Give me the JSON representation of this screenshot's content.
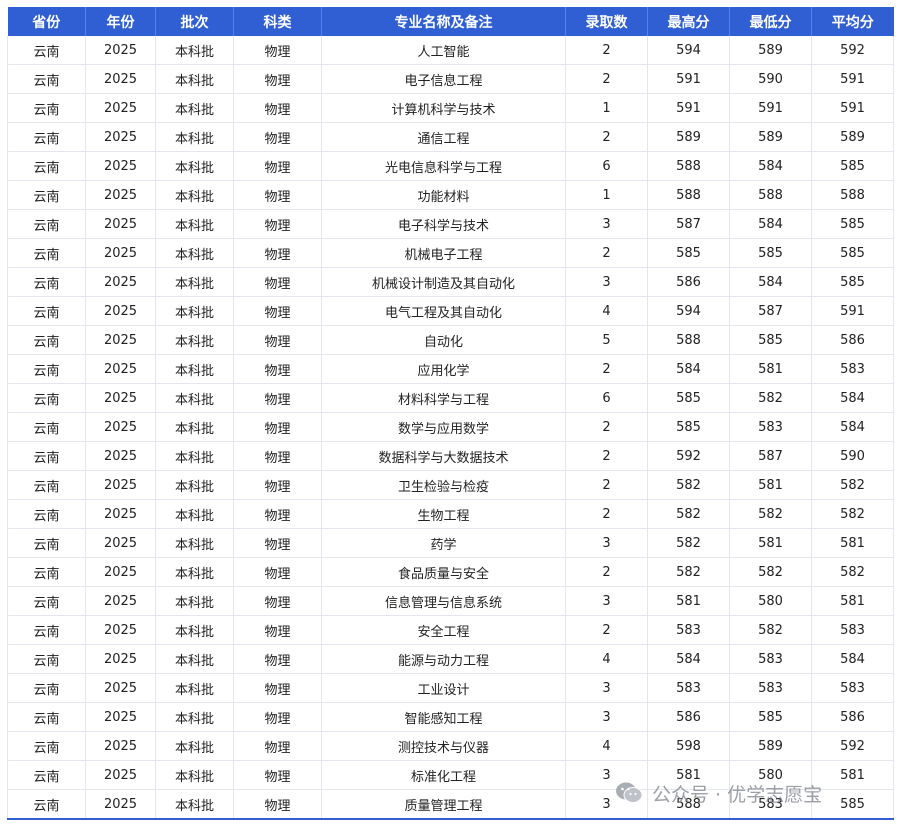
{
  "headers": [
    "省份",
    "年份",
    "批次",
    "科类",
    "专业名称及备注",
    "录取数",
    "最高分",
    "最低分",
    "平均分"
  ],
  "rows": [
    [
      "云南",
      "2025",
      "本科批",
      "物理",
      "人工智能",
      "2",
      "594",
      "589",
      "592"
    ],
    [
      "云南",
      "2025",
      "本科批",
      "物理",
      "电子信息工程",
      "2",
      "591",
      "590",
      "591"
    ],
    [
      "云南",
      "2025",
      "本科批",
      "物理",
      "计算机科学与技术",
      "1",
      "591",
      "591",
      "591"
    ],
    [
      "云南",
      "2025",
      "本科批",
      "物理",
      "通信工程",
      "2",
      "589",
      "589",
      "589"
    ],
    [
      "云南",
      "2025",
      "本科批",
      "物理",
      "光电信息科学与工程",
      "6",
      "588",
      "584",
      "585"
    ],
    [
      "云南",
      "2025",
      "本科批",
      "物理",
      "功能材料",
      "1",
      "588",
      "588",
      "588"
    ],
    [
      "云南",
      "2025",
      "本科批",
      "物理",
      "电子科学与技术",
      "3",
      "587",
      "584",
      "585"
    ],
    [
      "云南",
      "2025",
      "本科批",
      "物理",
      "机械电子工程",
      "2",
      "585",
      "585",
      "585"
    ],
    [
      "云南",
      "2025",
      "本科批",
      "物理",
      "机械设计制造及其自动化",
      "3",
      "586",
      "584",
      "585"
    ],
    [
      "云南",
      "2025",
      "本科批",
      "物理",
      "电气工程及其自动化",
      "4",
      "594",
      "587",
      "591"
    ],
    [
      "云南",
      "2025",
      "本科批",
      "物理",
      "自动化",
      "5",
      "588",
      "585",
      "586"
    ],
    [
      "云南",
      "2025",
      "本科批",
      "物理",
      "应用化学",
      "2",
      "584",
      "581",
      "583"
    ],
    [
      "云南",
      "2025",
      "本科批",
      "物理",
      "材料科学与工程",
      "6",
      "585",
      "582",
      "584"
    ],
    [
      "云南",
      "2025",
      "本科批",
      "物理",
      "数学与应用数学",
      "2",
      "585",
      "583",
      "584"
    ],
    [
      "云南",
      "2025",
      "本科批",
      "物理",
      "数据科学与大数据技术",
      "2",
      "592",
      "587",
      "590"
    ],
    [
      "云南",
      "2025",
      "本科批",
      "物理",
      "卫生检验与检疫",
      "2",
      "582",
      "581",
      "582"
    ],
    [
      "云南",
      "2025",
      "本科批",
      "物理",
      "生物工程",
      "2",
      "582",
      "582",
      "582"
    ],
    [
      "云南",
      "2025",
      "本科批",
      "物理",
      "药学",
      "3",
      "582",
      "581",
      "581"
    ],
    [
      "云南",
      "2025",
      "本科批",
      "物理",
      "食品质量与安全",
      "2",
      "582",
      "582",
      "582"
    ],
    [
      "云南",
      "2025",
      "本科批",
      "物理",
      "信息管理与信息系统",
      "3",
      "581",
      "580",
      "581"
    ],
    [
      "云南",
      "2025",
      "本科批",
      "物理",
      "安全工程",
      "2",
      "583",
      "582",
      "583"
    ],
    [
      "云南",
      "2025",
      "本科批",
      "物理",
      "能源与动力工程",
      "4",
      "584",
      "583",
      "584"
    ],
    [
      "云南",
      "2025",
      "本科批",
      "物理",
      "工业设计",
      "3",
      "583",
      "583",
      "583"
    ],
    [
      "云南",
      "2025",
      "本科批",
      "物理",
      "智能感知工程",
      "3",
      "586",
      "585",
      "586"
    ],
    [
      "云南",
      "2025",
      "本科批",
      "物理",
      "测控技术与仪器",
      "4",
      "598",
      "589",
      "592"
    ],
    [
      "云南",
      "2025",
      "本科批",
      "物理",
      "标准化工程",
      "3",
      "581",
      "580",
      "581"
    ],
    [
      "云南",
      "2025",
      "本科批",
      "物理",
      "质量管理工程",
      "3",
      "588",
      "583",
      "585"
    ]
  ],
  "watermark": {
    "text": "公众号 · 优学志愿宝",
    "icon": "wechat-icon"
  },
  "colors": {
    "header_bg": "#2f5fd3",
    "header_text": "#ffffff",
    "grid": "#e3e6ec",
    "watermark": "#8a8f98"
  }
}
